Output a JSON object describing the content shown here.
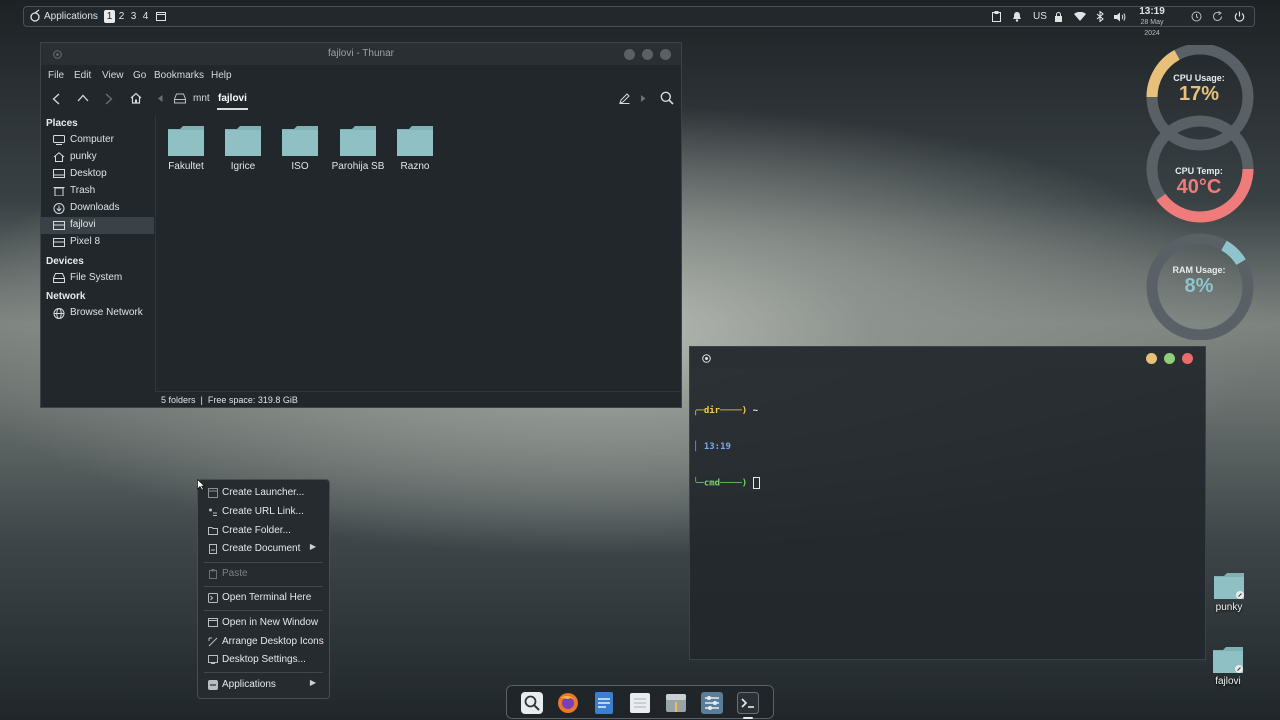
{
  "panel": {
    "apps_label": "Applications",
    "workspaces": [
      "1",
      "2",
      "3",
      "4"
    ],
    "active_workspace": "1",
    "keyboard_layout": "US",
    "clock_time": "13:19",
    "clock_date": "28 May 2024"
  },
  "thunar": {
    "title": "fajlovi - Thunar",
    "menu": [
      "File",
      "Edit",
      "View",
      "Go",
      "Bookmarks",
      "Help"
    ],
    "path": [
      "mnt",
      "fajlovi"
    ],
    "sidebar": {
      "places_heading": "Places",
      "places": [
        "Computer",
        "punky",
        "Desktop",
        "Trash",
        "Downloads",
        "fajlovi",
        "Pixel 8"
      ],
      "selected": "fajlovi",
      "devices_heading": "Devices",
      "devices": [
        "File System"
      ],
      "network_heading": "Network",
      "network": [
        "Browse Network"
      ]
    },
    "folders": [
      "Fakultet",
      "Igrice",
      "ISO",
      "Parohija SB",
      "Razno"
    ],
    "status": "5 folders  |  Free space: 319.8 GiB"
  },
  "terminal": {
    "line1_prefix": "╭─dir────) ",
    "line1_value": "~",
    "line2": "│ 13:19",
    "line3_prefix": "╰─cmd────) "
  },
  "context_menu": {
    "items": [
      {
        "label": "Create Launcher...",
        "icon": "launcher-icon"
      },
      {
        "label": "Create URL Link...",
        "icon": "link-icon"
      },
      {
        "label": "Create Folder...",
        "icon": "folder-icon"
      },
      {
        "label": "Create Document",
        "icon": "document-icon",
        "submenu": true
      },
      {
        "label": "Paste",
        "icon": "paste-icon",
        "disabled": true
      },
      {
        "label": "Open Terminal Here",
        "icon": "terminal-icon"
      },
      {
        "label": "Open in New Window",
        "icon": "window-icon"
      },
      {
        "label": "Arrange Desktop Icons",
        "icon": "arrange-icon"
      },
      {
        "label": "Desktop Settings...",
        "icon": "settings-icon"
      },
      {
        "label": "Applications",
        "icon": "applications-icon",
        "submenu": true
      }
    ]
  },
  "gauges": {
    "cpu_usage_label": "CPU Usage:",
    "cpu_usage_value": "17%",
    "cpu_usage_fraction": 0.17,
    "cpu_temp_label": "CPU Temp:",
    "cpu_temp_value": "40°C",
    "cpu_temp_fraction": 0.4,
    "ram_usage_label": "RAM Usage:",
    "ram_usage_value": "8%",
    "ram_usage_fraction": 0.08,
    "colors": {
      "cpu": "#e8c07a",
      "temp": "#ef7b7b",
      "ram": "#8fc4cc",
      "track": "#5a6166"
    }
  },
  "desktop_icons": [
    "punky",
    "fajlovi"
  ],
  "colors": {
    "folder": "#8fc0c4",
    "accent_green": "#7fd06a",
    "accent_yellow": "#f0d060",
    "accent_blue": "#7aa8e8"
  }
}
